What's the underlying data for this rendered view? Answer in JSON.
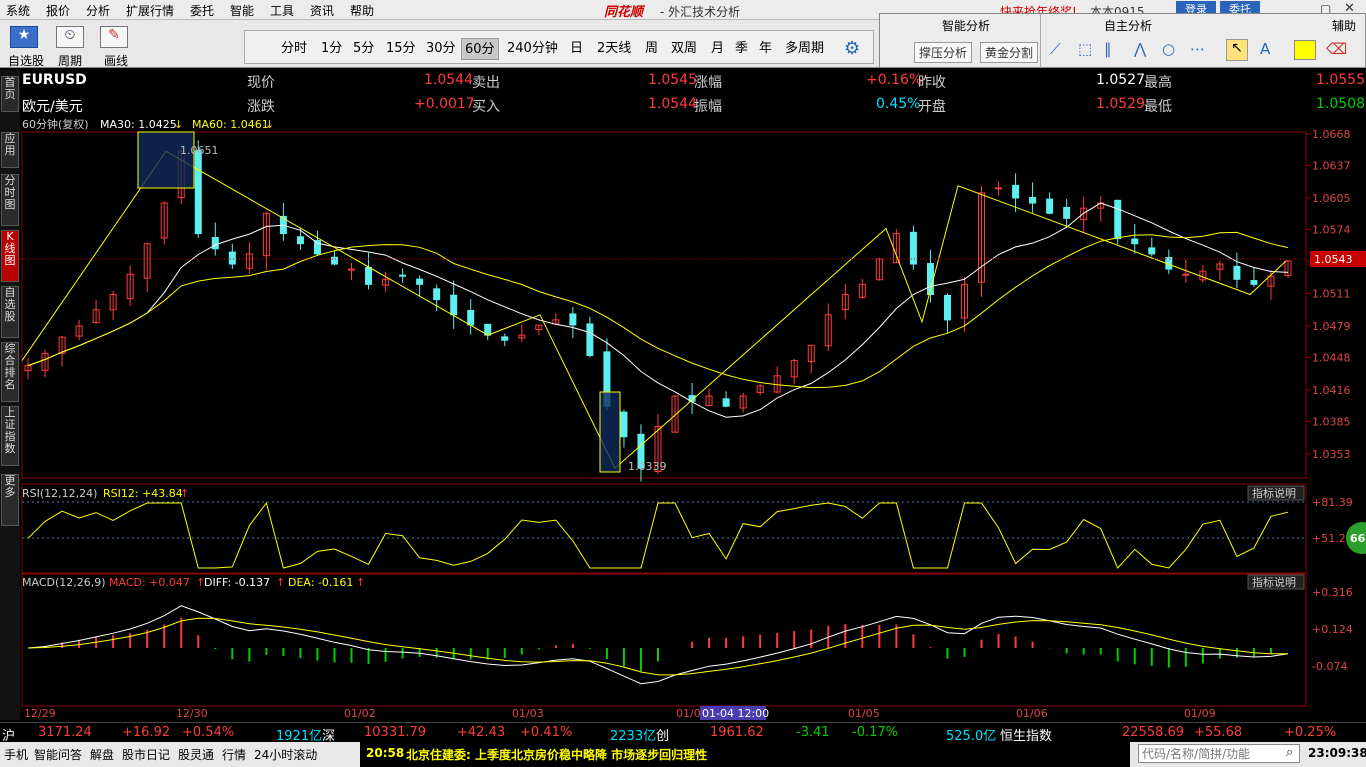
{
  "menu": [
    "系统",
    "报价",
    "分析",
    "扩展行情",
    "委托",
    "智能",
    "工具",
    "资讯",
    "帮助"
  ],
  "app": {
    "logo": "同花顺",
    "title": "- 外汇技术分析",
    "marquee": "快来抢年终奖!",
    "version": "本本0915",
    "btn_register": "登录",
    "btn_trade": "委托"
  },
  "toolbar": {
    "left_labels": [
      "自选股",
      "周期",
      "画线"
    ],
    "periods": [
      "分时",
      "1分",
      "5分",
      "15分",
      "30分",
      "60分",
      "240分钟",
      "日",
      "2天线",
      "周",
      "双周",
      "月",
      "季",
      "年",
      "多周期"
    ],
    "selected_period": "60分"
  },
  "right_panel": {
    "tab1": "智能分析",
    "tab2": "自主分析",
    "tab3": "辅助",
    "btn1": "撑压分析",
    "btn2": "黄金分割"
  },
  "leftnav": [
    {
      "label": "首页",
      "selected": false
    },
    {
      "label": "应用",
      "selected": false
    },
    {
      "label": "分时图",
      "selected": false
    },
    {
      "label": "K线图",
      "selected": true
    },
    {
      "label": "自选股",
      "selected": false
    },
    {
      "label": "综合排名",
      "selected": false
    },
    {
      "label": "上证指数",
      "selected": false
    },
    {
      "label": "更多",
      "selected": false
    }
  ],
  "quote": {
    "symbol": "EURUSD",
    "name": "欧元/美元",
    "l_price": "现价",
    "price": "1.0544",
    "l_sell": "卖出",
    "sell": "1.0545",
    "l_pct": "涨幅",
    "pct": "+0.16%",
    "l_prevclose": "昨收",
    "prevclose": "1.0527",
    "l_high": "最高",
    "high": "1.0555",
    "l_change": "涨跌",
    "change": "+0.0017",
    "l_buy": "买入",
    "buy": "1.0544",
    "l_amp": "振幅",
    "amp": "0.45%",
    "l_open": "开盘",
    "open": "1.0529",
    "l_low": "最低",
    "low": "1.0508"
  },
  "indicators": {
    "main_label": "60分钟(复权)",
    "ma30": "MA30: 1.0425",
    "ma60": "MA60: 1.0461",
    "rsi_label": "RSI(12,12,24)",
    "rsi12": "RSI12: +43.84",
    "macd_label": "MACD(12,26,9)",
    "macd": "MACD: +0.047",
    "diff": "DIFF: -0.137",
    "dea": "DEA: -0.161",
    "explain": "指标说明",
    "peak_label": "1.0651",
    "trough_label": "1.0339",
    "current_price_tag": "1.0543",
    "crosshair_time": "01-04 12:00",
    "badge": "66"
  },
  "chart_data": {
    "type": "candlestick",
    "price_axis": [
      "1.0668",
      "1.0637",
      "1.0605",
      "1.0574",
      "1.0543",
      "1.0511",
      "1.0479",
      "1.0448",
      "1.0416",
      "1.0385",
      "1.0353"
    ],
    "rsi_axis": [
      "+81.39",
      "+51.22"
    ],
    "macd_axis": [
      "+0.316",
      "+0.124",
      "-0.074"
    ],
    "time_axis": [
      "12/29",
      "12/30",
      "01/02",
      "01/03",
      "01/04",
      "01/05",
      "01/06",
      "01/09"
    ],
    "close_series": [
      1.044,
      1.0452,
      1.0468,
      1.0479,
      1.0495,
      1.051,
      1.053,
      1.056,
      1.06,
      1.0651,
      1.057,
      1.0555,
      1.054,
      1.055,
      1.059,
      1.057,
      1.056,
      1.055,
      1.054,
      1.0535,
      1.052,
      1.0525,
      1.0528,
      1.052,
      1.0505,
      1.049,
      1.048,
      1.047,
      1.0465,
      1.047,
      1.048,
      1.0485,
      1.048,
      1.045,
      1.04,
      1.037,
      1.0339,
      1.038,
      1.041,
      1.0405,
      1.041,
      1.04,
      1.041,
      1.042,
      1.043,
      1.0445,
      1.046,
      1.049,
      1.051,
      1.052,
      1.0545,
      1.057,
      1.054,
      1.051,
      1.0485,
      1.052,
      1.061,
      1.0615,
      1.0605,
      1.06,
      1.059,
      1.0585,
      1.0595,
      1.06,
      1.0565,
      1.056,
      1.055,
      1.0535,
      1.053,
      1.0533,
      1.054,
      1.0525,
      1.052,
      1.0528,
      1.0543
    ]
  },
  "status": {
    "sh_label": "沪",
    "sh": "3171.24",
    "sh_chg": "+16.92",
    "sh_pct": "+0.54%",
    "sh_amt": "1921亿",
    "sz_label": "深",
    "sz": "10331.79",
    "sz_chg": "+42.43",
    "sz_pct": "+0.41%",
    "sz_amt": "2233亿",
    "cy_label": "创",
    "cy": "1961.62",
    "cy_chg": "-3.41",
    "cy_pct": "-0.17%",
    "cy_amt": "525.0亿",
    "hs_label": "恒生指数",
    "hs": "22558.69",
    "hs_chg": "+55.68",
    "hs_pct": "+0.25%"
  },
  "bottombar": {
    "items": [
      "手机",
      "智能问答",
      "解盘",
      "股市日记",
      "股灵通",
      "行情",
      "24小时滚动"
    ],
    "news_time": "20:58",
    "news": "北京住建委: 上季度北京房价稳中略降 市场逐步回归理性",
    "search_placeholder": "代码/名称/简拼/功能",
    "clock": "23:09:38"
  }
}
